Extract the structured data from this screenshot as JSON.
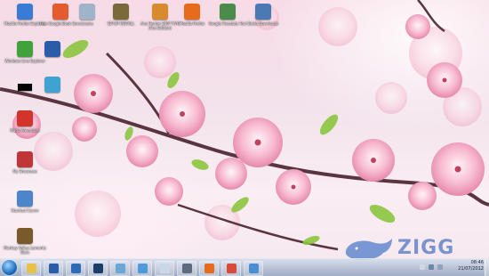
{
  "desktop": {
    "icons": [
      {
        "label": "Mozilla Firefox Explorer",
        "icon": "browser-icon",
        "color": "#3a7bd5"
      },
      {
        "label": "Free Google Book Guru",
        "icon": "book-icon",
        "color": "#e45b2e"
      },
      {
        "label": "Lixeira",
        "icon": "recycle-bin-icon",
        "color": "#9fb4c9"
      },
      {
        "label": "SETUP INSTALL",
        "icon": "setup-icon",
        "color": "#7a6a3a"
      },
      {
        "label": "Ana Hunter 2007 PVG (Fun Edition)",
        "icon": "game-icon",
        "color": "#d88a2c"
      },
      {
        "label": "Mozilla Firefox",
        "icon": "firefox-icon",
        "color": "#e66b1c"
      },
      {
        "label": "Google Translate Tool",
        "icon": "translate-icon",
        "color": "#4b8b4b"
      },
      {
        "label": "Baixe Downloads",
        "icon": "download-icon",
        "color": "#4a79b3"
      },
      {
        "label": "Windows Live Explorer",
        "icon": "windows-live-icon",
        "color": "#3fa23a"
      },
      {
        "label": "",
        "icon": "word-document-icon",
        "color": "#2b5caa"
      },
      {
        "label": "",
        "icon": "redacted-icon",
        "color": "#000000"
      },
      {
        "label": "",
        "icon": "cartoon-icon",
        "color": "#3fa2d0"
      },
      {
        "label": "Mario Adventure",
        "icon": "mario-icon",
        "color": "#d2332a"
      },
      {
        "label": "My Showcase",
        "icon": "showcase-icon",
        "color": "#c03535"
      },
      {
        "label": "Stardust Canon",
        "icon": "stardust-icon",
        "color": "#4a86c9"
      },
      {
        "label": "Monkey Valley Lamente Wars",
        "icon": "monkey-icon",
        "color": "#7a5a2a"
      }
    ]
  },
  "watermark": {
    "text": "ZIGG",
    "icon": "whale-icon",
    "color": "#4f7bc9"
  },
  "taskbar": {
    "start_icon": "windows-start-icon",
    "pinned": [
      {
        "name": "explorer",
        "icon": "folder-icon",
        "color": "#e8c04a"
      },
      {
        "name": "word",
        "icon": "word-icon",
        "color": "#2b5caa"
      },
      {
        "name": "media-player",
        "icon": "media-player-icon",
        "color": "#2e6bb7"
      },
      {
        "name": "photoshop",
        "icon": "photoshop-icon",
        "color": "#1b3f6b"
      },
      {
        "name": "paint",
        "icon": "paint-icon",
        "color": "#6aa7d6"
      },
      {
        "name": "messenger",
        "icon": "messenger-icon",
        "color": "#4f9bd9"
      },
      {
        "name": "notepad",
        "icon": "notepad-icon",
        "color": "#c9d7e8"
      },
      {
        "name": "calculator",
        "icon": "calculator-icon",
        "color": "#5c6b7e"
      },
      {
        "name": "firefox",
        "icon": "firefox-icon",
        "color": "#e66b1c"
      },
      {
        "name": "chrome",
        "icon": "chrome-icon",
        "color": "#d94a3a"
      },
      {
        "name": "monitor",
        "icon": "monitor-icon",
        "color": "#4a8fd1"
      }
    ],
    "tray": {
      "time": "08:46",
      "date": "21/07/2012"
    }
  }
}
